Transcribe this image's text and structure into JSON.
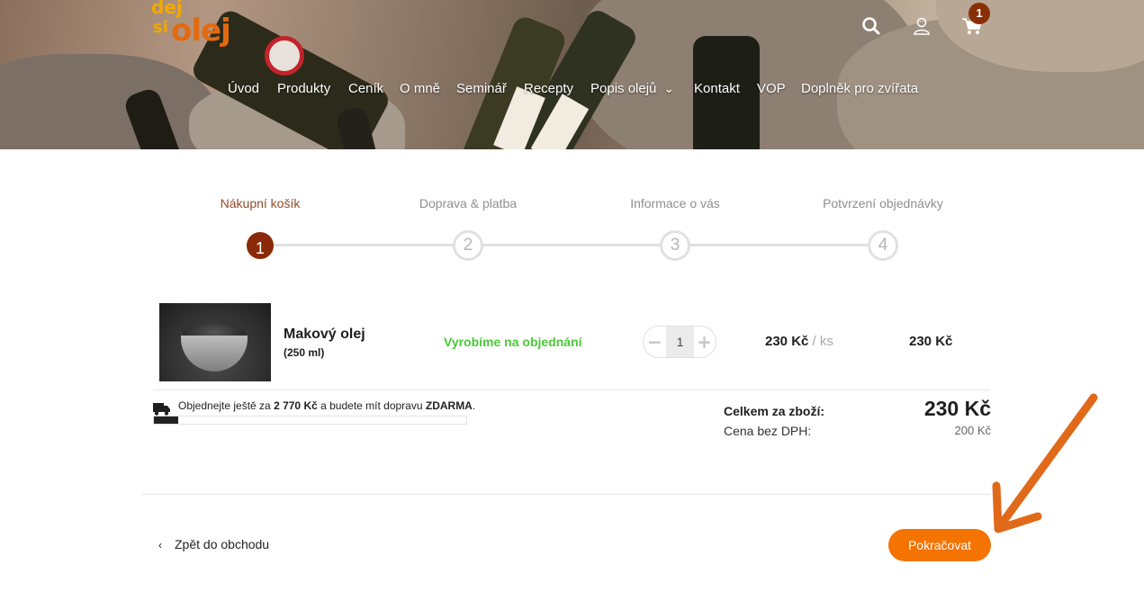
{
  "brand": {
    "logo_top": "dej",
    "logo_small": "si",
    "logo_main": "olej"
  },
  "nav": {
    "items": [
      {
        "label": "Úvod"
      },
      {
        "label": "Produkty"
      },
      {
        "label": "Ceník"
      },
      {
        "label": "O mně"
      },
      {
        "label": "Seminář"
      },
      {
        "label": "Recepty"
      },
      {
        "label": "Popis olejů"
      },
      {
        "label": "Kontakt"
      },
      {
        "label": "VOP"
      },
      {
        "label": "Doplněk pro zvířata"
      }
    ],
    "dropdown_caret": "⌄"
  },
  "header_icons": {
    "search": "search-icon",
    "account": "user-icon",
    "cart": "cart-icon",
    "cart_count": "1"
  },
  "steps": [
    {
      "label": "Nákupní košík",
      "number": "1",
      "active": true
    },
    {
      "label": "Doprava & platba",
      "number": "2",
      "active": false
    },
    {
      "label": "Informace o vás",
      "number": "3",
      "active": false
    },
    {
      "label": "Potvrzení objednávky",
      "number": "4",
      "active": false
    }
  ],
  "cart": {
    "item": {
      "name": "Makový olej",
      "size": "(250 ml)",
      "status": "Vyrobíme na objednání",
      "quantity": "1",
      "qty_minus": "−",
      "qty_plus": "+",
      "unit_price": "230 Kč",
      "unit_suffix": "/ ks",
      "total": "230 Kč"
    },
    "shipping": {
      "text_prefix": "Objednejte ještě za ",
      "amount": "2 770 Kč",
      "text_middle": " a budete mít dopravu ",
      "free_word": "ZDARMA",
      "text_suffix": ".",
      "progress_fraction": 0.077
    },
    "totals": {
      "label": "Celkem za zboží:",
      "value": "230 Kč",
      "net_label": "Cena bez DPH:",
      "net_value": "200 Kč"
    }
  },
  "actions": {
    "back_chevron": "‹",
    "back_label": "Zpět do obchodu",
    "continue_label": "Pokračovat"
  },
  "colors": {
    "accent": "#f57300",
    "step_active": "#8a2a08",
    "status_green": "#4cc73a",
    "annotation_arrow": "#e0691a"
  }
}
